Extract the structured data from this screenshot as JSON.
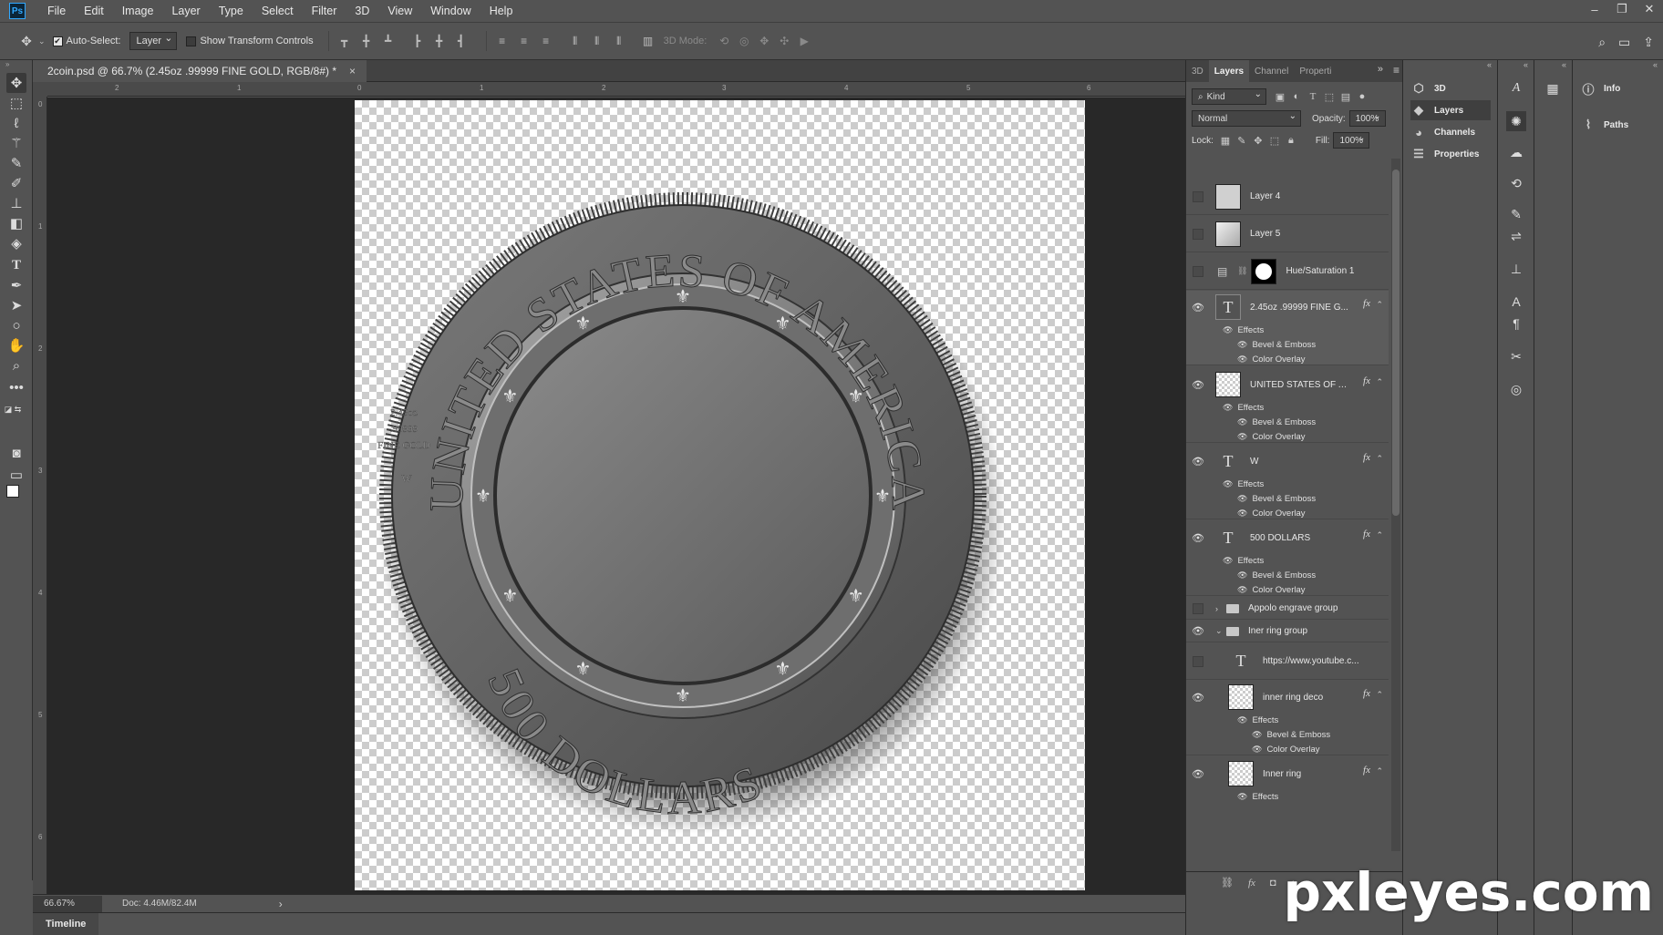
{
  "app": {
    "logo": "Ps"
  },
  "menu": [
    "File",
    "Edit",
    "Image",
    "Layer",
    "Type",
    "Select",
    "Filter",
    "3D",
    "View",
    "Window",
    "Help"
  ],
  "window_controls": {
    "minimize": "–",
    "restore": "❐",
    "close": "✕"
  },
  "options_bar": {
    "auto_select_label": "Auto-Select:",
    "auto_select_checked": true,
    "auto_select_target": "Layer",
    "show_transform_label": "Show Transform Controls",
    "show_transform_checked": false,
    "mode3d_label": "3D Mode:"
  },
  "document": {
    "tab_title": "2coin.psd @ 66.7% (2.45oz .99999 FINE GOLD, RGB/8#) *",
    "close": "×",
    "ruler_top_ticks": [
      "2",
      "1",
      "0",
      "1",
      "2",
      "3",
      "4",
      "5",
      "6"
    ],
    "ruler_left_ticks": [
      "0",
      "1",
      "2",
      "3",
      "4",
      "5",
      "6"
    ]
  },
  "coin": {
    "top_text": "UNITED STATES OF AMERICA",
    "bottom_text": "500 DOLLARS",
    "weight_line1": "2.45oz",
    "weight_line2": ".99999",
    "weight_line3": "FINE GOLD",
    "mint_mark": "W"
  },
  "status": {
    "zoom": "66.67%",
    "doc_size": "Doc: 4.46M/82.4M",
    "arrow": "›"
  },
  "timeline": {
    "label": "Timeline"
  },
  "layers_panel": {
    "tabs": [
      "3D",
      "Layers",
      "Channel",
      "Properti"
    ],
    "active_tab": "Layers",
    "filter_kind": "Kind",
    "blend_mode": "Normal",
    "opacity_label": "Opacity:",
    "opacity_value": "100%",
    "lock_label": "Lock:",
    "fill_label": "Fill:",
    "fill_value": "100%",
    "effects_label": "Effects",
    "bevel_label": "Bevel & Emboss",
    "overlay_label": "Color Overlay",
    "fx_label": "fx",
    "layers": [
      {
        "name": "Layer 4",
        "visible": false
      },
      {
        "name": "Layer 5",
        "visible": false
      },
      {
        "name": "Hue/Saturation 1",
        "visible": false
      },
      {
        "name": "2.45oz .99999 FINE G...",
        "visible": true
      },
      {
        "name": "UNITED STATES OF AM...",
        "visible": true
      },
      {
        "name": "W",
        "visible": true
      },
      {
        "name": "500 DOLLARS",
        "visible": true
      },
      {
        "name": "Appolo engrave group",
        "visible": false
      },
      {
        "name": "Iner ring group",
        "visible": true
      },
      {
        "name": "https://www.youtube.c...",
        "visible": false
      },
      {
        "name": "inner ring deco",
        "visible": true
      },
      {
        "name": "Inner ring",
        "visible": true
      }
    ]
  },
  "dock": {
    "items": [
      "3D",
      "Layers",
      "Channels",
      "Properties"
    ],
    "active": "Layers",
    "info_label": "Info",
    "paths_label": "Paths"
  },
  "watermark": "pxleyes.com",
  "colors": {
    "ui_bg": "#535353",
    "dark_bg": "#282828",
    "accent": "#31a8ff"
  }
}
